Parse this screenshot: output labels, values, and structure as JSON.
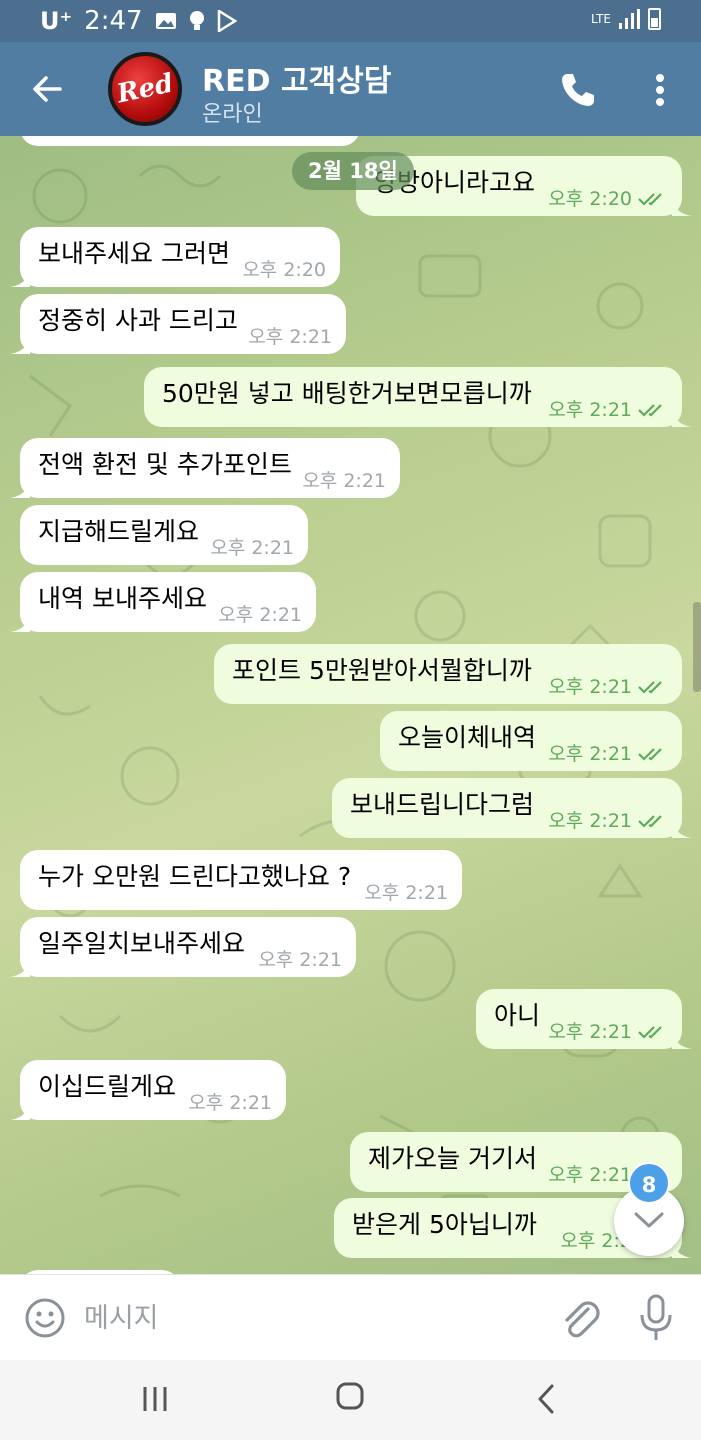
{
  "status_bar": {
    "carrier": "U⁺",
    "time": "2:47",
    "network": "LTE",
    "icons": [
      "image-icon",
      "bulb-icon",
      "play-store-icon",
      "signal-icon",
      "battery-icon"
    ]
  },
  "header": {
    "title": "RED 고객상담",
    "subtitle": "온라인",
    "avatar_text": "Red",
    "icons": [
      "back-arrow-icon",
      "phone-icon",
      "more-vertical-icon"
    ]
  },
  "chat": {
    "date_label": "2월 18일",
    "messages": [
      {
        "dir": "out",
        "text": "양방아니라고요",
        "time": "오후 2:20"
      },
      {
        "dir": "in",
        "text": "보내주세요 그러면",
        "time": "오후 2:20"
      },
      {
        "dir": "in",
        "text": "정중히 사과 드리고",
        "time": "오후 2:21"
      },
      {
        "dir": "out",
        "text": "50만원 넣고 배팅한거보면모릅니까",
        "time": "오후 2:21"
      },
      {
        "dir": "in",
        "text": "전액 환전 및 추가포인트",
        "time": "오후 2:21"
      },
      {
        "dir": "in",
        "text": "지급해드릴게요",
        "time": "오후 2:21"
      },
      {
        "dir": "in",
        "text": "내역 보내주세요",
        "time": "오후 2:21"
      },
      {
        "dir": "out",
        "text": "포인트 5만원받아서뭘합니까",
        "time": "오후 2:21"
      },
      {
        "dir": "out",
        "text": "오늘이체내역",
        "time": "오후 2:21"
      },
      {
        "dir": "out",
        "text": "보내드립니다그럼",
        "time": "오후 2:21"
      },
      {
        "dir": "in",
        "text": "누가 오만원 드린다고했나요 ?",
        "time": "오후 2:21"
      },
      {
        "dir": "in",
        "text": "일주일치보내주세요",
        "time": "오후 2:21"
      },
      {
        "dir": "out",
        "text": "아니",
        "time": "오후 2:21"
      },
      {
        "dir": "in",
        "text": "이십드릴게요",
        "time": "오후 2:21"
      },
      {
        "dir": "out",
        "text": "제가오늘 거기서",
        "time": "오후 2:21"
      },
      {
        "dir": "out",
        "text": "받은게 5아닙니까",
        "time": "오후 2:2"
      }
    ],
    "unread_badge": "8",
    "scroll_down_icon": "chevron-down-icon"
  },
  "composer": {
    "placeholder": "메시지",
    "icons": [
      "emoji-icon",
      "attach-paperclip-icon",
      "microphone-icon"
    ]
  },
  "colors": {
    "header": "#517da2",
    "status_bar": "#4d6f8f",
    "outgoing_bubble": "#effdde",
    "incoming_bubble": "#ffffff",
    "read_check": "#5fa95b",
    "badge": "#4ca0e8"
  },
  "nav_bar": {
    "icons": [
      "recent-apps-icon",
      "home-icon",
      "back-icon"
    ]
  }
}
